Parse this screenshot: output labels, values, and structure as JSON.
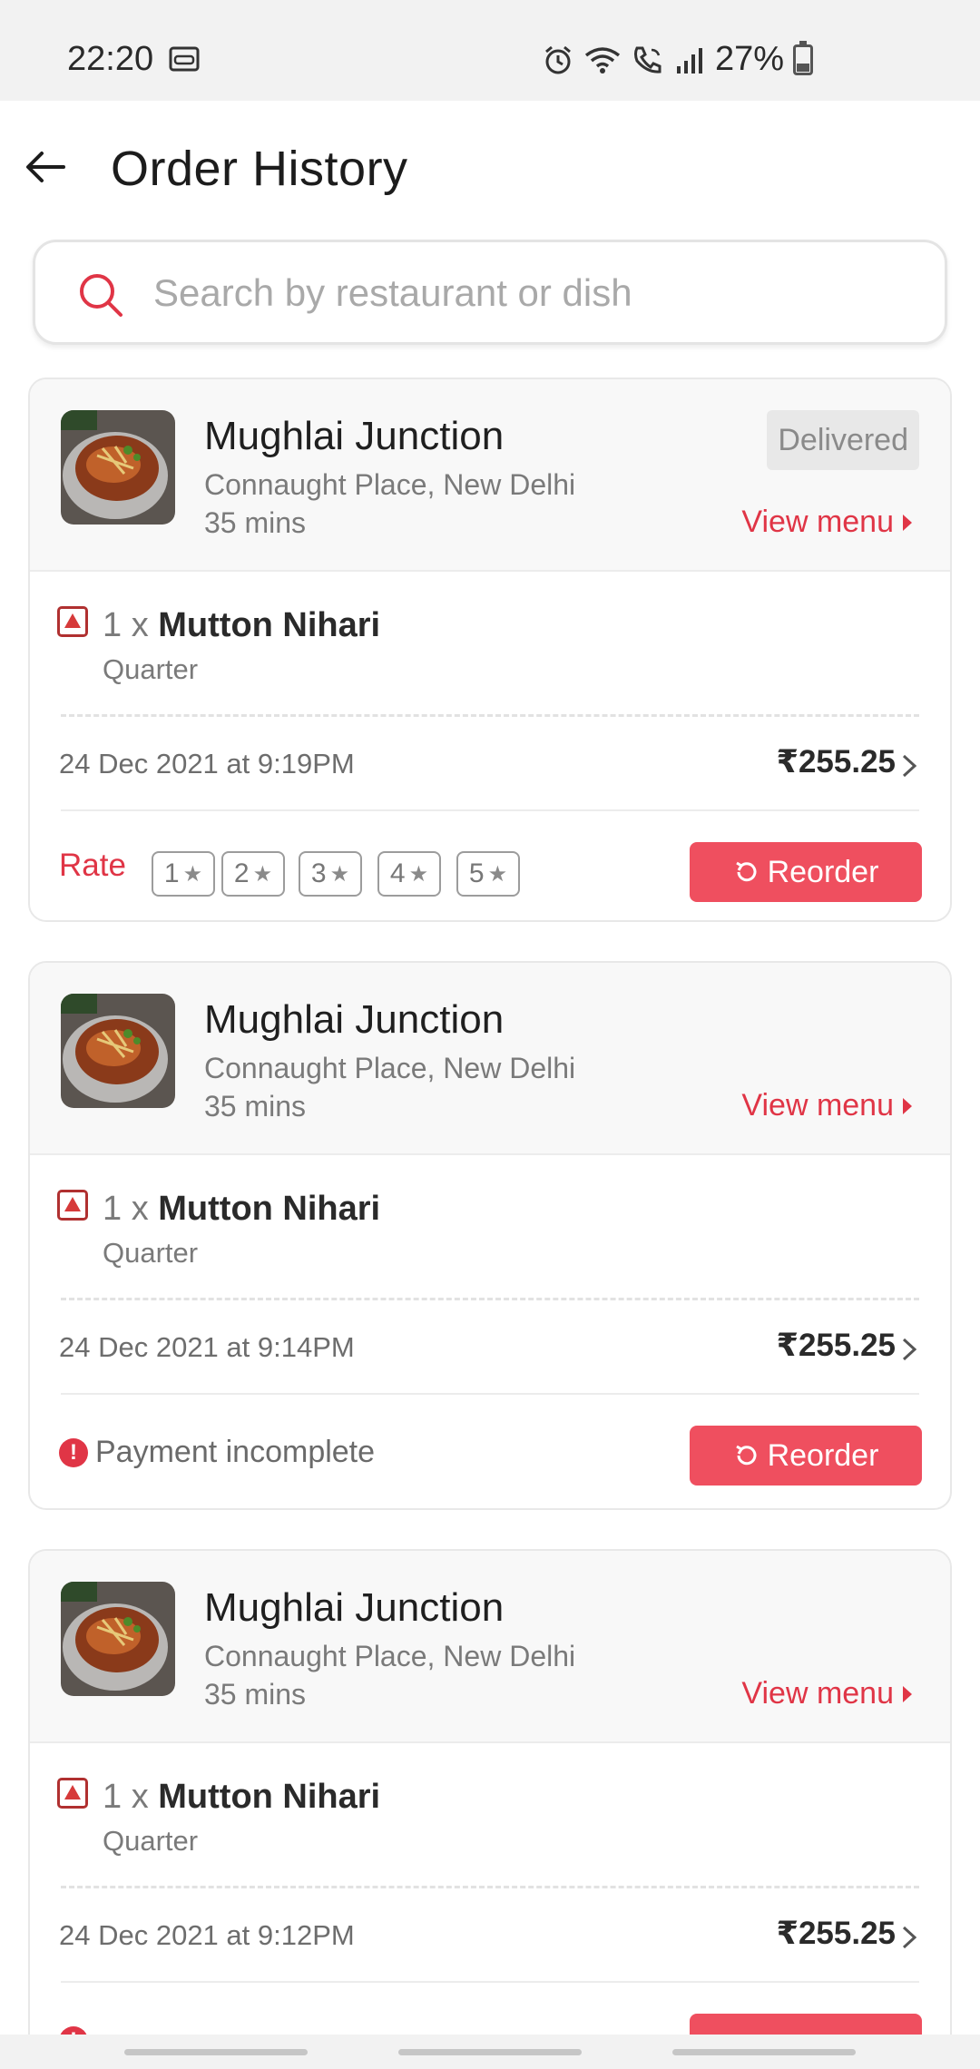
{
  "status_bar": {
    "time": "22:20",
    "battery": "27%"
  },
  "header": {
    "title": "Order History"
  },
  "search": {
    "placeholder": "Search by restaurant or dish"
  },
  "orders": [
    {
      "restaurant": "Mughlai Junction",
      "location": "Connaught Place, New Delhi",
      "eta": "35 mins",
      "status": "Delivered",
      "view_menu": "View menu",
      "qty": "1 x",
      "item": "Mutton Nihari",
      "variant": "Quarter",
      "date": "24 Dec 2021 at 9:19PM",
      "price": "₹255.25",
      "rate_label": "Rate",
      "ratings": [
        "1",
        "2",
        "3",
        "4",
        "5"
      ],
      "reorder": "Reorder"
    },
    {
      "restaurant": "Mughlai Junction",
      "location": "Connaught Place, New Delhi",
      "eta": "35 mins",
      "view_menu": "View menu",
      "qty": "1 x",
      "item": "Mutton Nihari",
      "variant": "Quarter",
      "date": "24 Dec 2021 at 9:14PM",
      "price": "₹255.25",
      "payment_status": "Payment incomplete",
      "reorder": "Reorder"
    },
    {
      "restaurant": "Mughlai Junction",
      "location": "Connaught Place, New Delhi",
      "eta": "35 mins",
      "view_menu": "View menu",
      "qty": "1 x",
      "item": "Mutton Nihari",
      "variant": "Quarter",
      "date": "24 Dec 2021 at 9:12PM",
      "price": "₹255.25"
    }
  ],
  "colors": {
    "accent": "#e03546",
    "button": "#ef4f5f",
    "card_header": "#f8f8f8"
  },
  "icons": [
    "back-arrow-icon",
    "search-icon",
    "non-veg-icon",
    "chevron-right-icon",
    "star-icon",
    "reorder-icon",
    "alert-icon",
    "alarm-icon",
    "wifi-icon",
    "call-icon",
    "signal-icon",
    "battery-icon"
  ]
}
